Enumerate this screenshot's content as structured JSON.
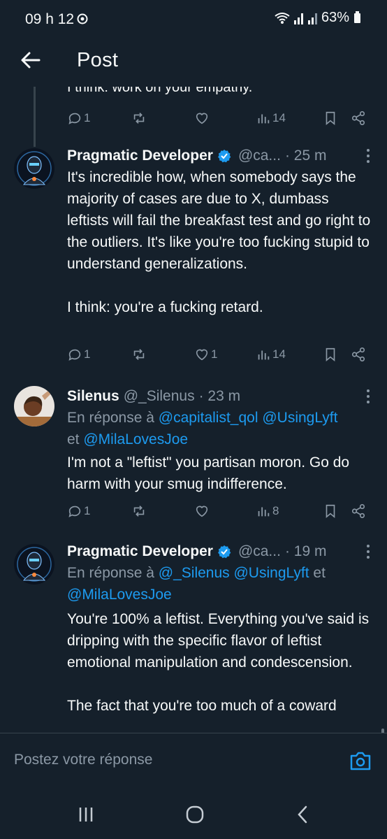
{
  "status_bar": {
    "time": "09 h 12",
    "battery": "63%"
  },
  "header": {
    "title": "Post"
  },
  "previous_tweet": {
    "text_fragment": "I think: work on your empathy.",
    "replies": "1",
    "likes": "",
    "views": "14"
  },
  "tweets": [
    {
      "name": "Pragmatic Developer",
      "handle": "@ca...",
      "time": "· 25 m",
      "reply_prefix": "",
      "reply_to": [],
      "body": "It's incredible how, when somebody says the majority of cases are due to X, dumbass leftists will fail the breakfast test and go right to the outliers. It's like you're too fucking stupid to understand generalizations.\n\nI think: you're a fucking retard.",
      "replies": "1",
      "likes": "1",
      "views": "14"
    },
    {
      "name": "Silenus",
      "handle": "@_Silenus",
      "time": "· 23 m",
      "reply_prefix": "En réponse à",
      "reply_line1_links": "@capitalist_qol @UsingLyft",
      "reply_line2_prefix": "et",
      "reply_line2_link": "@MilaLovesJoe",
      "body": "I'm not a \"leftist\" you partisan moron. Go do harm with your smug indifference.",
      "replies": "1",
      "likes": "",
      "views": "8"
    },
    {
      "name": "Pragmatic Developer",
      "handle": "@ca...",
      "time": "· 19 m",
      "reply_prefix": "En réponse à",
      "reply_line1_links": "@_Silenus @UsingLyft",
      "reply_line1_suffix": "et",
      "reply_line2_link": "@MilaLovesJoe",
      "body": "You're 100% a leftist. Everything you've said is dripping with the specific flavor of leftist emotional manipulation and condescension.\n\nThe fact that you're too much of a coward"
    }
  ],
  "composer": {
    "placeholder": "Postez votre réponse"
  },
  "icons": {
    "verified": "verified-badge-icon",
    "camera": "camera-icon"
  },
  "colors": {
    "background": "#15202b",
    "link": "#1d9bf0",
    "muted": "#8b98a5"
  }
}
